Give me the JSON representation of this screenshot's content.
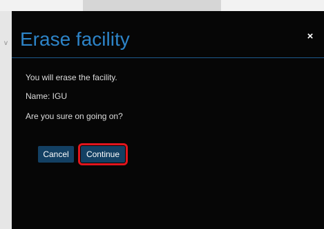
{
  "backdrop": {
    "side_text": "v"
  },
  "dialog": {
    "title": "Erase facility",
    "close_glyph": "×",
    "body": {
      "line_1": "You will erase the facility.",
      "line_2": "Name: IGU",
      "line_3": "Are you sure on going on?"
    },
    "buttons": {
      "cancel_label": "Cancel",
      "continue_label": "Continue"
    }
  },
  "colors": {
    "title_blue": "#2d84c8",
    "button_navy": "#134063",
    "highlight_red": "#e0151d",
    "modal_background": "#060606"
  },
  "icons": {
    "close": "close-icon"
  }
}
